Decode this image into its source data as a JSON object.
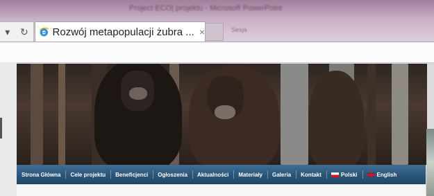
{
  "browser": {
    "background_text": "Project ECO| projektu - Microsoft PowerPoint",
    "ghost_tab": "Sesja",
    "tab": {
      "title": "Rozwój metapopulacji żubra ...",
      "close_glyph": "×",
      "icon": "ie-icon"
    },
    "nav": {
      "dropdown_glyph": "▾",
      "refresh_glyph": "↻"
    }
  },
  "page": {
    "menu": [
      {
        "label": "Strona Główna"
      },
      {
        "label": "Cele projektu"
      },
      {
        "label": "Beneficjenci"
      },
      {
        "label": "Ogłoszenia"
      },
      {
        "label": "Aktualności"
      },
      {
        "label": "Materiały"
      },
      {
        "label": "Galeria"
      },
      {
        "label": "Kontakt"
      },
      {
        "label": "Polski",
        "flag": "pl"
      },
      {
        "label": "English",
        "flag": "en"
      }
    ],
    "colors": {
      "menu_bg": "#2a5578",
      "menu_text": "#ffffff"
    }
  }
}
